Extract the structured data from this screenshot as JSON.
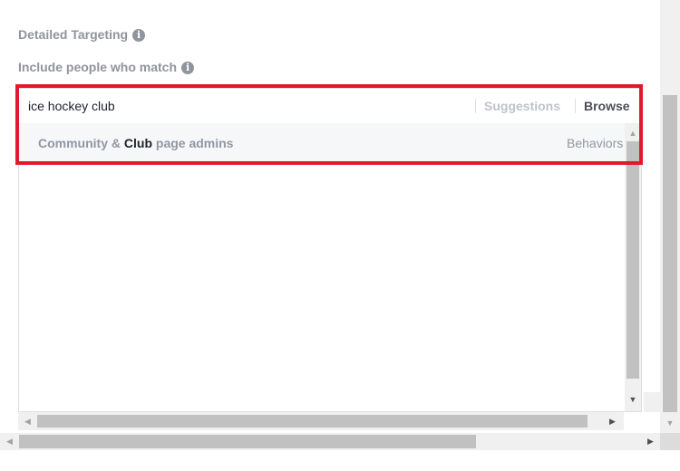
{
  "targeting": {
    "section_title": "Detailed Targeting",
    "include_label": "Include people who match"
  },
  "search": {
    "value": "ice hockey club"
  },
  "tabs": {
    "suggestions": "Suggestions",
    "browse": "Browse"
  },
  "results": [
    {
      "name_before": "Community & ",
      "name_match": "Club",
      "name_after": " page admins",
      "category": "Behaviors"
    }
  ],
  "icons": {
    "info": "info-icon",
    "scroll_up": "chevron-up-icon",
    "scroll_down": "chevron-down-icon",
    "scroll_left": "chevron-left-icon",
    "scroll_right": "chevron-right-icon"
  },
  "colors": {
    "highlight": "#e2192c",
    "label_gray": "#90949c",
    "tab_active": "#4b4f56",
    "tab_inactive": "#bec3c9",
    "result_bg": "#f6f7f9"
  }
}
